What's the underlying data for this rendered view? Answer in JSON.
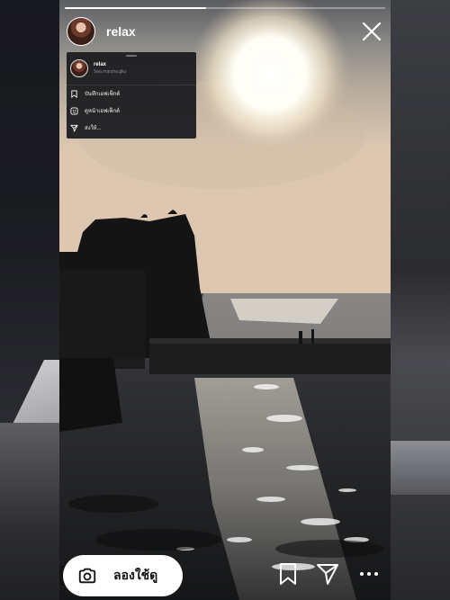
{
  "story": {
    "username": "relax",
    "progress": 0.44
  },
  "context_menu": {
    "name": "relax",
    "subtitle": "Sea marsha.gliu",
    "items": [
      {
        "icon": "bookmark-icon",
        "label": "บันทึกเอฟเฟ็กต์"
      },
      {
        "icon": "effect-page-icon",
        "label": "ดูหน้าเอฟเฟ็กต์"
      },
      {
        "icon": "send-icon",
        "label": "ส่งให้..."
      }
    ]
  },
  "bottom_bar": {
    "try_label": "ลองใช้ดู",
    "icons": [
      "camera-icon",
      "bookmark-icon",
      "send-icon",
      "more-icon"
    ]
  },
  "header_icons": [
    "avatar",
    "close-icon"
  ]
}
